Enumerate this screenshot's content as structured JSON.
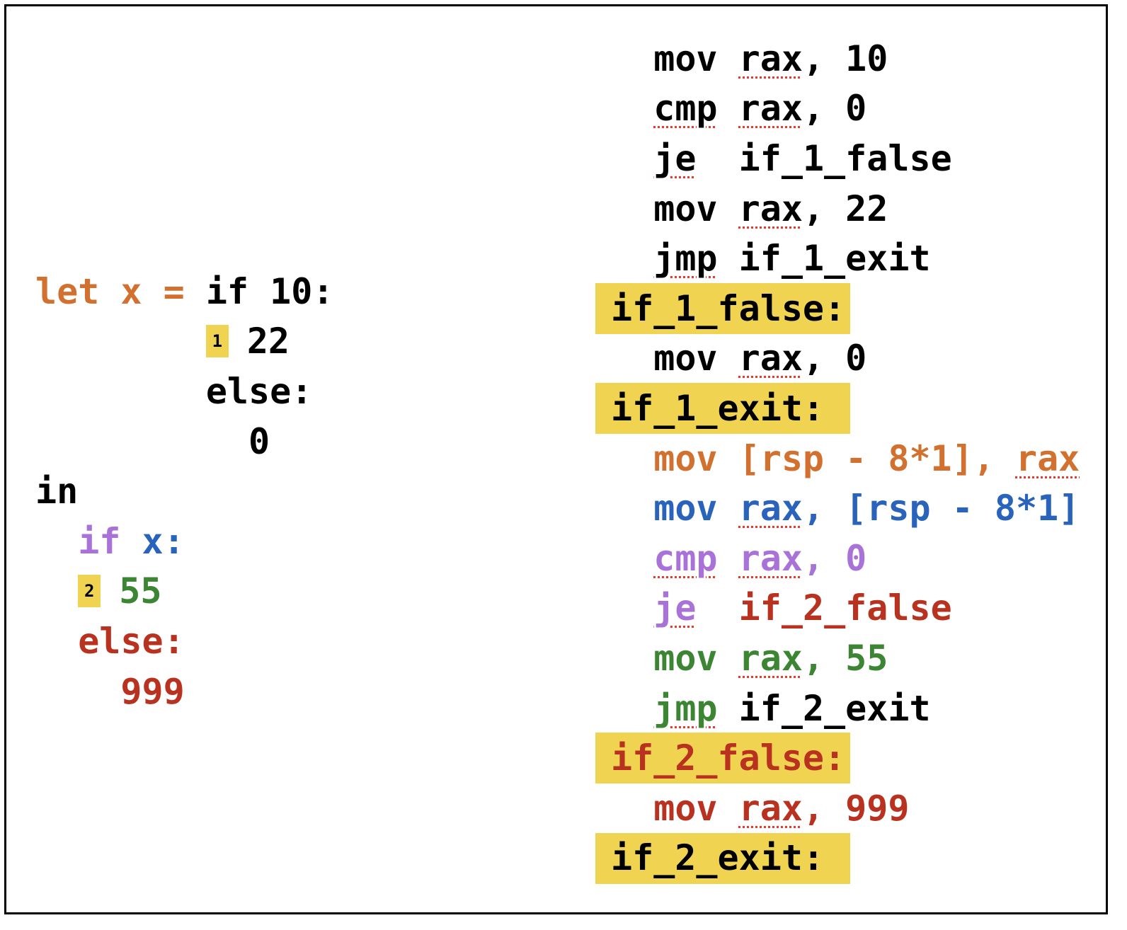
{
  "colors": {
    "black": "#000000",
    "orange": "#d2712f",
    "blue": "#2a63bb",
    "purple": "#a872d9",
    "green": "#3c8533",
    "red": "#b8321f",
    "highlight": "#f0d451"
  },
  "source_code": {
    "lines": [
      {
        "segments": [
          {
            "text": "let x = ",
            "color": "orange"
          },
          {
            "text": "if 10:",
            "color": "black"
          }
        ]
      },
      {
        "badge": "1",
        "prefix": "        ",
        "segments": [
          {
            "text": "22",
            "color": "black"
          }
        ]
      },
      {
        "segments": [
          {
            "text": "        else:",
            "color": "black"
          }
        ]
      },
      {
        "segments": [
          {
            "text": "          0",
            "color": "black"
          }
        ]
      },
      {
        "segments": [
          {
            "text": "in",
            "color": "black"
          }
        ]
      },
      {
        "segments": [
          {
            "text": "  if ",
            "color": "purple"
          },
          {
            "text": "x:",
            "color": "blue"
          }
        ]
      },
      {
        "badge": "2",
        "prefix": "  ",
        "segments": [
          {
            "text": "55",
            "color": "green"
          }
        ]
      },
      {
        "segments": [
          {
            "text": "  else:",
            "color": "red"
          }
        ]
      },
      {
        "segments": [
          {
            "text": "    999",
            "color": "red"
          }
        ]
      }
    ]
  },
  "assembly": {
    "lines": [
      {
        "segments": [
          {
            "text": "  "
          },
          {
            "text": "mov ",
            "color": "black"
          },
          {
            "text": "rax",
            "color": "black",
            "squiggle": true
          },
          {
            "text": ", 10",
            "color": "black"
          }
        ]
      },
      {
        "segments": [
          {
            "text": "  "
          },
          {
            "text": "cmp",
            "color": "black",
            "squiggle": true
          },
          {
            "text": " ",
            "color": "black"
          },
          {
            "text": "rax",
            "color": "black",
            "squiggle": true
          },
          {
            "text": ", 0",
            "color": "black"
          }
        ]
      },
      {
        "segments": [
          {
            "text": "  "
          },
          {
            "text": "je",
            "color": "black",
            "squiggle": true
          },
          {
            "text": "  if_1_false",
            "color": "black"
          }
        ]
      },
      {
        "segments": [
          {
            "text": "  "
          },
          {
            "text": "mov ",
            "color": "black"
          },
          {
            "text": "rax",
            "color": "black",
            "squiggle": true
          },
          {
            "text": ", 22",
            "color": "black"
          }
        ]
      },
      {
        "segments": [
          {
            "text": "  "
          },
          {
            "text": "jmp",
            "color": "black",
            "squiggle": true
          },
          {
            "text": " if_1_exit",
            "color": "black"
          }
        ]
      },
      {
        "label": true,
        "segments": [
          {
            "text": "if_1_false:",
            "color": "black"
          }
        ]
      },
      {
        "segments": [
          {
            "text": "  "
          },
          {
            "text": "mov ",
            "color": "black"
          },
          {
            "text": "rax",
            "color": "black",
            "squiggle": true
          },
          {
            "text": ", 0",
            "color": "black"
          }
        ]
      },
      {
        "label": true,
        "segments": [
          {
            "text": "if_1_exit:",
            "color": "black"
          }
        ]
      },
      {
        "segments": [
          {
            "text": "  "
          },
          {
            "text": "mov [rsp - 8*1], ",
            "color": "orange"
          },
          {
            "text": "rax",
            "color": "orange",
            "squiggle": true
          }
        ]
      },
      {
        "segments": [
          {
            "text": "  "
          },
          {
            "text": "mov ",
            "color": "blue"
          },
          {
            "text": "rax",
            "color": "blue",
            "squiggle": true
          },
          {
            "text": ", [rsp - 8*1]",
            "color": "blue"
          }
        ]
      },
      {
        "segments": [
          {
            "text": "  "
          },
          {
            "text": "cmp",
            "color": "purple",
            "squiggle": true
          },
          {
            "text": " ",
            "color": "purple"
          },
          {
            "text": "rax",
            "color": "purple",
            "squiggle": true
          },
          {
            "text": ", 0",
            "color": "purple"
          }
        ]
      },
      {
        "segments": [
          {
            "text": "  "
          },
          {
            "text": "je",
            "color": "purple",
            "squiggle": true
          },
          {
            "text": "  ",
            "color": "purple"
          },
          {
            "text": "if_2_false",
            "color": "red"
          }
        ]
      },
      {
        "segments": [
          {
            "text": "  "
          },
          {
            "text": "mov ",
            "color": "green"
          },
          {
            "text": "rax",
            "color": "green",
            "squiggle": true
          },
          {
            "text": ", 55",
            "color": "green"
          }
        ]
      },
      {
        "segments": [
          {
            "text": "  "
          },
          {
            "text": "jmp",
            "color": "green",
            "squiggle": true
          },
          {
            "text": " ",
            "color": "green"
          },
          {
            "text": "if_2_exit",
            "color": "black"
          }
        ]
      },
      {
        "label": true,
        "segments": [
          {
            "text": "if_2_false:",
            "color": "red"
          }
        ]
      },
      {
        "segments": [
          {
            "text": "  "
          },
          {
            "text": "mov ",
            "color": "red"
          },
          {
            "text": "rax",
            "color": "red",
            "squiggle": true
          },
          {
            "text": ", 999",
            "color": "red"
          }
        ]
      },
      {
        "label": true,
        "segments": [
          {
            "text": "if_2_exit:",
            "color": "black"
          }
        ]
      }
    ]
  }
}
